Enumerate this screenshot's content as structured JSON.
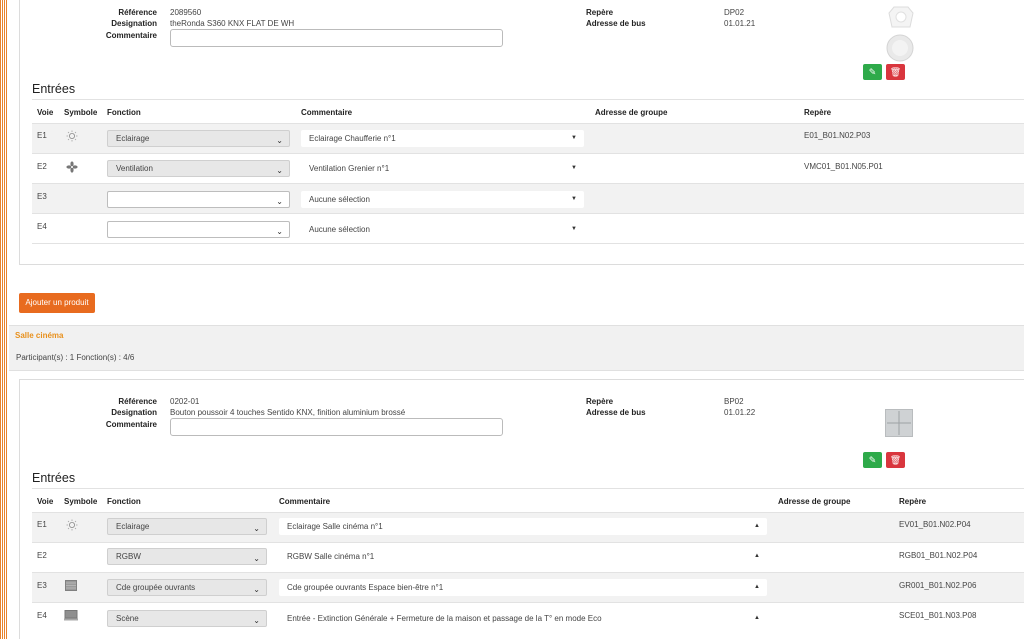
{
  "product1": {
    "labels": {
      "reference": "Référence",
      "designation": "Designation",
      "commentaire": "Commentaire",
      "repere": "Repère",
      "adresse_bus": "Adresse de bus"
    },
    "reference": "2089560",
    "designation": "theRonda S360 KNX FLAT DE WH",
    "repere": "DP02",
    "adresse_bus": "01.01.21",
    "section_title": "Entrées",
    "headers": {
      "voie": "Voie",
      "symbole": "Symbole",
      "fonction": "Fonction",
      "commentaire": "Commentaire",
      "adresse_groupe": "Adresse de groupe",
      "repere": "Repère"
    },
    "rows": [
      {
        "voie": "E1",
        "icon": "lightbulb-icon",
        "fonction": "Eclairage",
        "commentaire": "Eclairage Chaufferie n°1",
        "repere": "E01_B01.N02.P03"
      },
      {
        "voie": "E2",
        "icon": "fan-icon",
        "fonction": "Ventilation",
        "commentaire": "Ventilation Grenier n°1",
        "repere": "VMC01_B01.N05.P01"
      },
      {
        "voie": "E3",
        "icon": "",
        "fonction": "",
        "commentaire": "Aucune sélection",
        "repere": ""
      },
      {
        "voie": "E4",
        "icon": "",
        "fonction": "",
        "commentaire": "Aucune sélection",
        "repere": ""
      }
    ]
  },
  "add_product_label": "Ajouter un produit",
  "room": {
    "name": "Salle cinéma",
    "summary": "Participant(s) : 1 Fonction(s) : 4/6"
  },
  "product2": {
    "labels": {
      "reference": "Référence",
      "designation": "Designation",
      "commentaire": "Commentaire",
      "repere": "Repère",
      "adresse_bus": "Adresse de bus"
    },
    "reference": "0202-01",
    "designation": "Bouton poussoir 4 touches Sentido KNX, finition aluminium brossé",
    "repere": "BP02",
    "adresse_bus": "01.01.22",
    "section_title": "Entrées",
    "headers": {
      "voie": "Voie",
      "symbole": "Symbole",
      "fonction": "Fonction",
      "commentaire": "Commentaire",
      "adresse_groupe": "Adresse de groupe",
      "repere": "Repère"
    },
    "rows": [
      {
        "voie": "E1",
        "icon": "lightbulb-icon",
        "fonction": "Eclairage",
        "commentaire": "Eclairage Salle cinéma n°1",
        "repere": "EV01_B01.N02.P04"
      },
      {
        "voie": "E2",
        "icon": "",
        "fonction": "RGBW",
        "commentaire": "RGBW Salle cinéma n°1",
        "repere": "RGB01_B01.N02.P04"
      },
      {
        "voie": "E3",
        "icon": "shutter-icon",
        "fonction": "Cde groupée ouvrants",
        "commentaire": "Cde groupée ouvrants Espace bien-être n°1",
        "repere": "GR001_B01.N02.P06"
      },
      {
        "voie": "E4",
        "icon": "scene-icon",
        "fonction": "Scène",
        "commentaire": "Entrée - Extinction Générale + Fermeture de la maison et passage de la T° en mode Eco",
        "repere": "SCE01_B01.N03.P08"
      }
    ]
  },
  "colors": {
    "accent": "#e86b1f",
    "edit": "#2eaa4a",
    "delete": "#d9363e",
    "room_title": "#e8901c"
  }
}
